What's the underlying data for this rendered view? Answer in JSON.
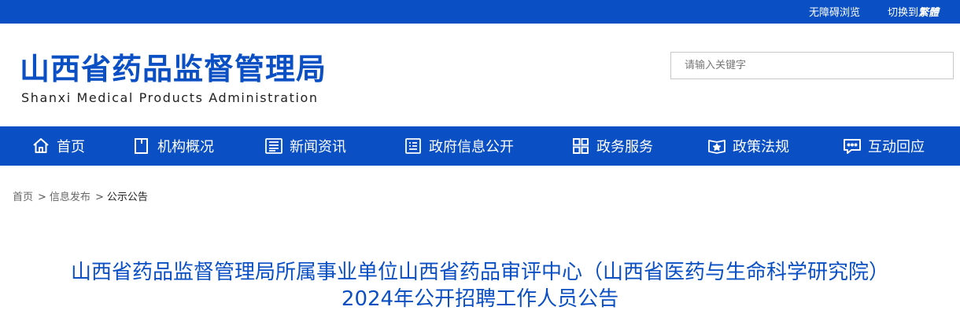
{
  "topbar": {
    "accessibility_label": "无障碍浏览",
    "language_prefix": "切换到",
    "language_target": "繁體"
  },
  "header": {
    "logo_cn": "山西省药品监督管理局",
    "logo_en": "Shanxi Medical Products Administration"
  },
  "search": {
    "placeholder": "请输入关键字"
  },
  "nav": {
    "items": [
      {
        "label": "首页",
        "icon": "home-icon"
      },
      {
        "label": "机构概况",
        "icon": "document-icon"
      },
      {
        "label": "新闻资讯",
        "icon": "newspaper-icon"
      },
      {
        "label": "政府信息公开",
        "icon": "info-list-icon"
      },
      {
        "label": "政务服务",
        "icon": "grid-icon"
      },
      {
        "label": "政策法规",
        "icon": "book-star-icon"
      },
      {
        "label": "互动回应",
        "icon": "chat-icon"
      }
    ]
  },
  "breadcrumb": {
    "items": [
      "首页",
      "信息发布",
      "公示公告"
    ],
    "separator": ">"
  },
  "article": {
    "title": "山西省药品监督管理局所属事业单位山西省药品审评中心（山西省医药与生命科学研究院）2024年公开招聘工作人员公告"
  },
  "colors": {
    "brand_blue": "#0a4fc4",
    "white": "#ffffff"
  }
}
